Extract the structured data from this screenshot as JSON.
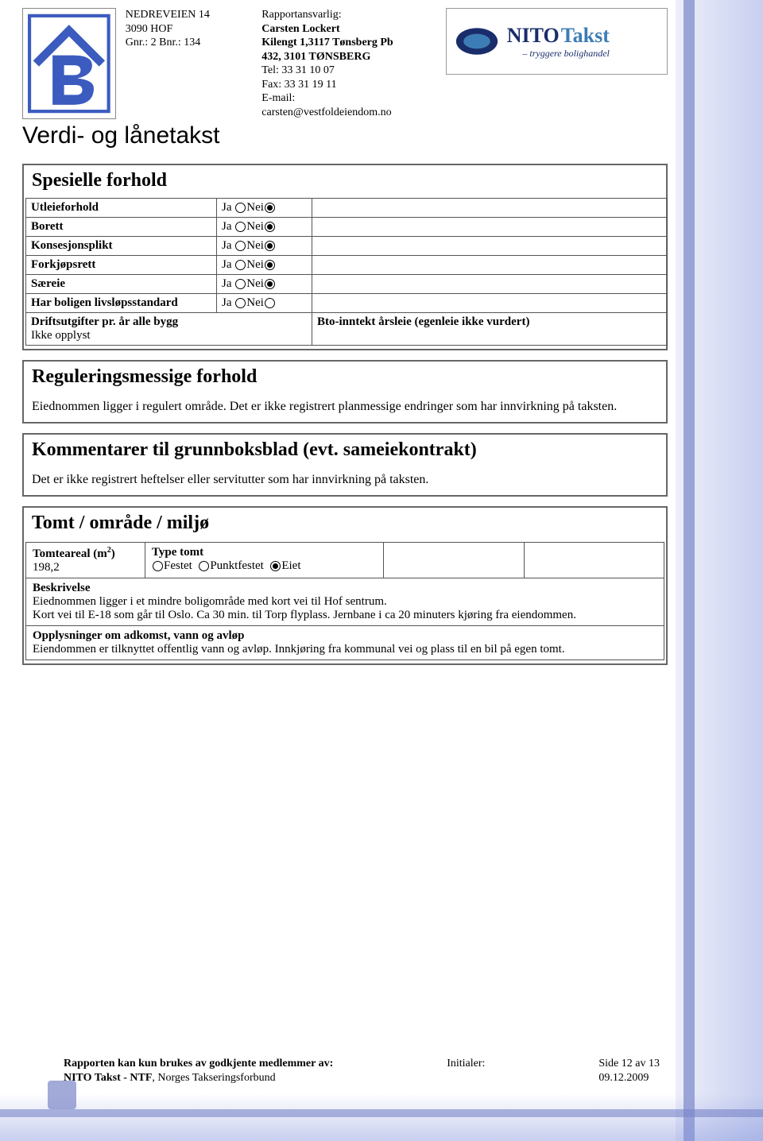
{
  "header": {
    "address": {
      "line1": "NEDREVEIEN 14",
      "line2": "3090 HOF",
      "line3": "Gnr.: 2 Bnr.: 134"
    },
    "responsible": {
      "label": "Rapportansvarlig:",
      "name": "Carsten Lockert",
      "addr1": "Kilengt 1,3117 Tønsberg Pb",
      "addr2": "432, 3101 TØNSBERG",
      "tel": "Tel: 33 31 10 07",
      "fax": "Fax: 33 31 19 11",
      "email_lbl": "E-mail:",
      "email": "carsten@vestfoldeiendom.no"
    },
    "brand": {
      "name1": "NITO",
      "name2": "Takst",
      "tag": "– tryggere bolighandel"
    }
  },
  "title": "Verdi- og lånetakst",
  "spesielle": {
    "heading": "Spesielle forhold",
    "rows": [
      {
        "label": "Utleieforhold",
        "ja": false,
        "nei": true
      },
      {
        "label": "Borett",
        "ja": false,
        "nei": true
      },
      {
        "label": "Konsesjonsplikt",
        "ja": false,
        "nei": true
      },
      {
        "label": "Forkjøpsrett",
        "ja": false,
        "nei": true
      },
      {
        "label": "Særeie",
        "ja": false,
        "nei": true
      },
      {
        "label": "Har boligen livsløpsstandard",
        "ja": false,
        "nei": null
      }
    ],
    "ja_txt": "Ja",
    "nei_txt": "Nei",
    "drift_label": "Driftsutgifter pr. år alle bygg",
    "drift_val": "Ikke opplyst",
    "bto_label": "Bto-inntekt årsleie (egenleie ikke vurdert)"
  },
  "regulering": {
    "heading": "Reguleringsmessige forhold",
    "text": "Eiednommen ligger i regulert område. Det er ikke registrert planmessige endringer som har innvirkning på taksten."
  },
  "kommentarer": {
    "heading": "Kommentarer til grunnboksblad (evt. sameiekontrakt)",
    "text": "Det er ikke registrert heftelser eller servitutter som har innvirkning på taksten."
  },
  "tomt": {
    "heading": "Tomt / område / miljø",
    "tomteareal_label": "Tomteareal (m",
    "tomteareal_sup": "2",
    "tomteareal_end": ")",
    "tomteareal_val": "198,2",
    "type_label": "Type tomt",
    "opt_festet": "Festet",
    "opt_punkt": "Punktfestet",
    "opt_eiet": "Eiet",
    "beskriv_label": "Beskrivelse",
    "beskriv_text": "Eiednommen ligger i et mindre boligområde med kort vei til Hof sentrum.\nKort vei til E-18 som går til Oslo. Ca 30 min. til Torp flyplass. Jernbane i ca 20 minuters kjøring fra eiendommen.",
    "oppl_label": "Opplysninger om adkomst, vann og avløp",
    "oppl_text": "Eiendommen er tilknyttet offentlig vann og avløp. Innkjøring fra kommunal vei og plass til en bil på egen tomt."
  },
  "footer": {
    "l1": "Rapporten kan kun brukes av godkjente medlemmer av:",
    "l2_a": "NITO Takst - NTF",
    "l2_b": ", Norges Takseringsforbund",
    "init": "Initialer:",
    "page": "Side 12 av 13",
    "date": "09.12.2009"
  }
}
